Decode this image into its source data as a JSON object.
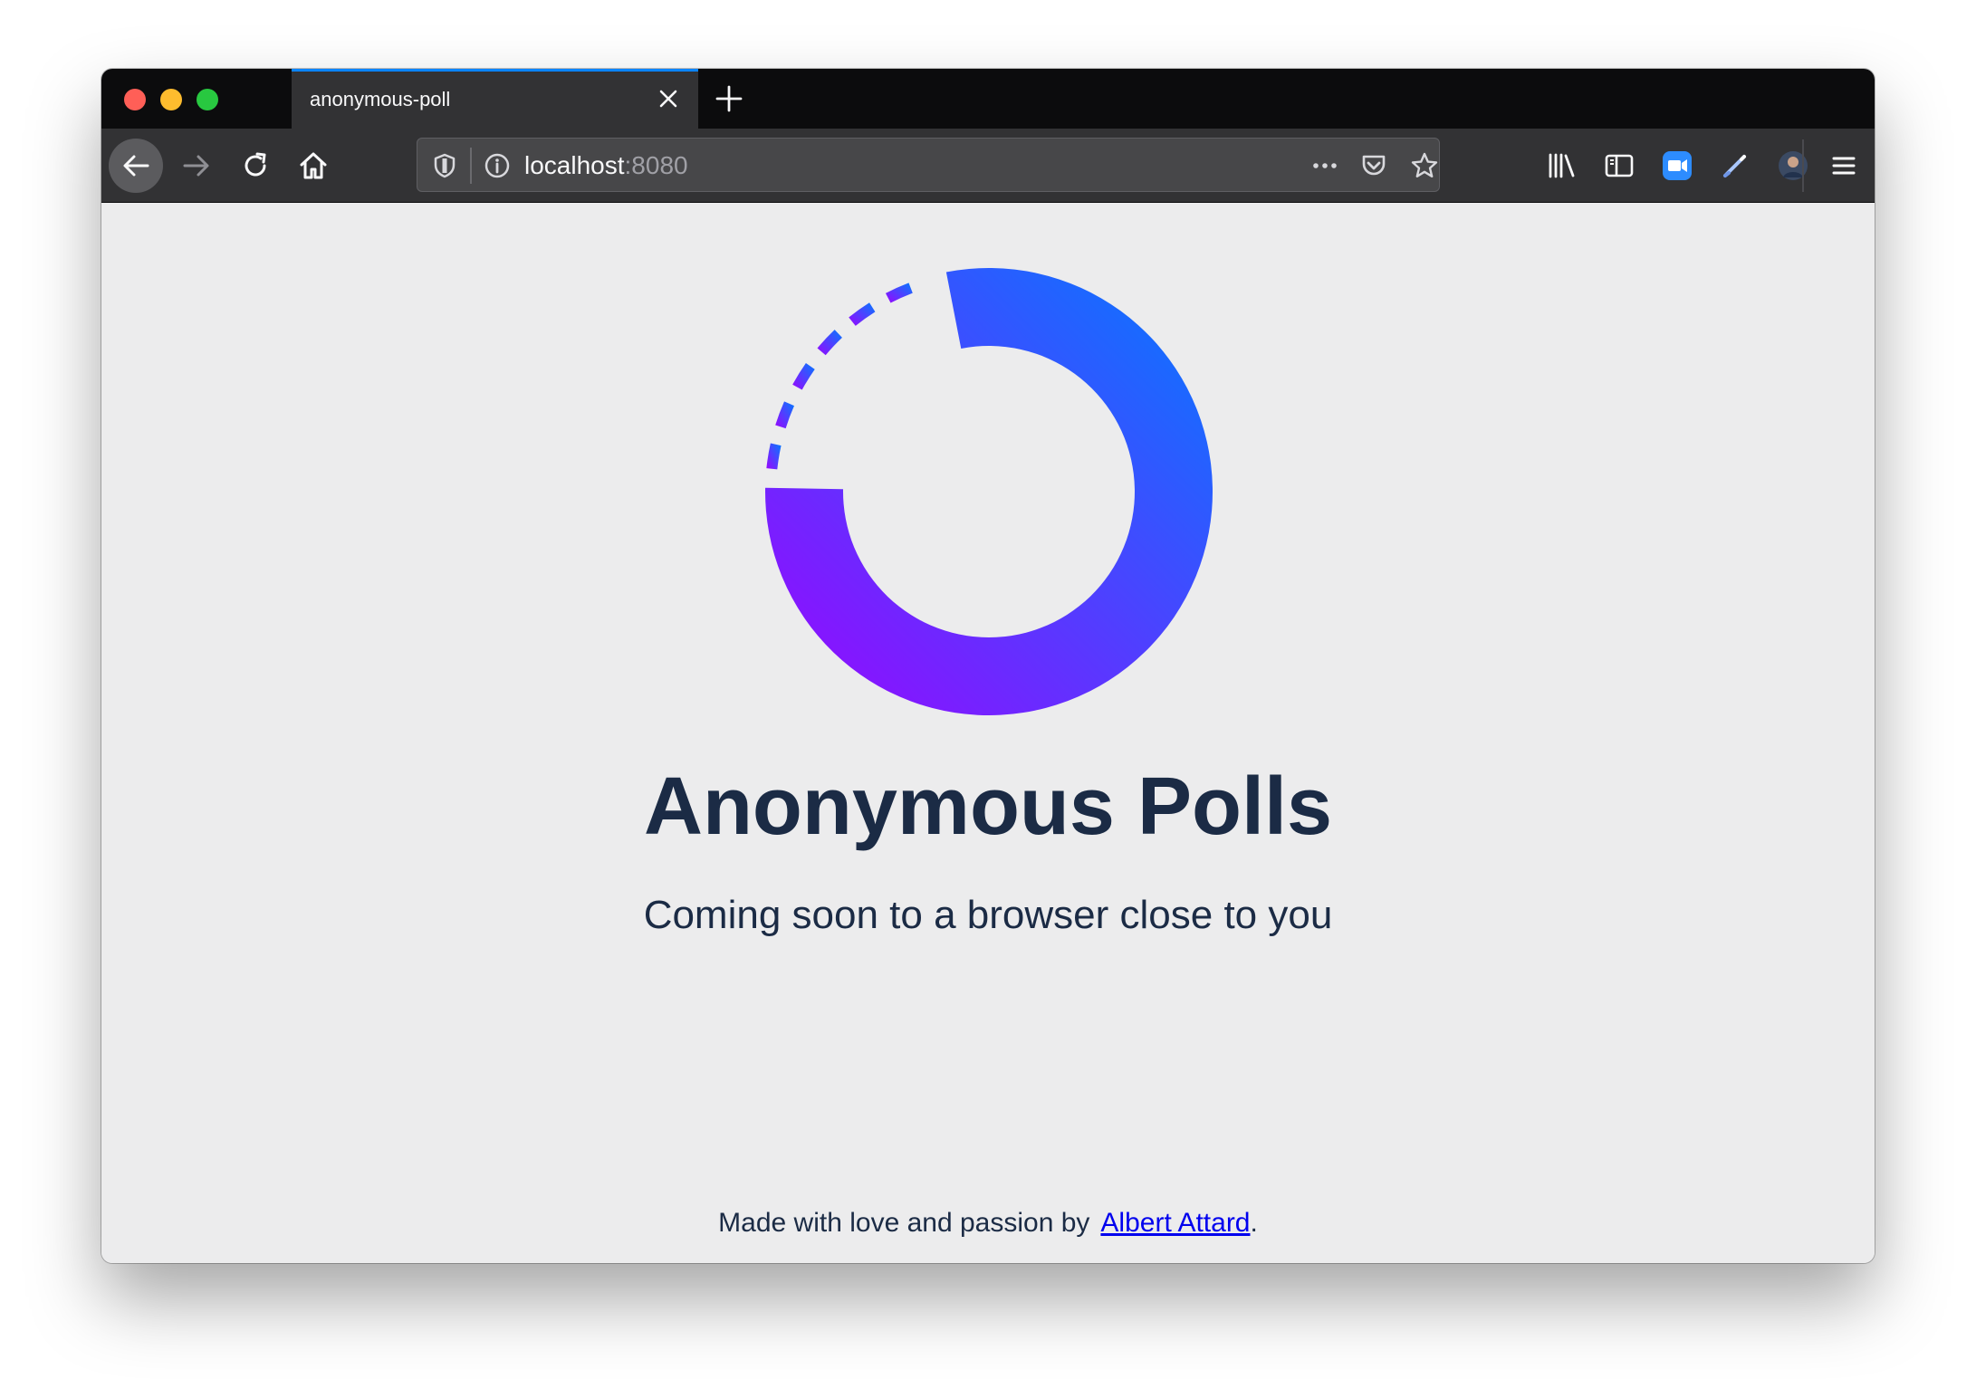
{
  "browser": {
    "tab_title": "anonymous-poll",
    "url_host": "localhost",
    "url_port": ":8080",
    "accent_color": "#0a84ff",
    "icons": [
      "back-icon",
      "forward-icon",
      "reload-icon",
      "home-icon",
      "shield-icon",
      "info-icon",
      "more-icon",
      "pocket-icon",
      "star-icon",
      "library-icon",
      "sidebar-icon",
      "zoom-icon",
      "pen-icon",
      "avatar",
      "menu-icon"
    ]
  },
  "page": {
    "title": "Anonymous Polls",
    "subtitle": "Coming soon to a browser close to you",
    "footer_text": "Made with love and passion by",
    "footer_link": "Albert Attard",
    "footer_end": ".",
    "logo_colors": [
      "#047aff",
      "#9a05ff"
    ]
  }
}
